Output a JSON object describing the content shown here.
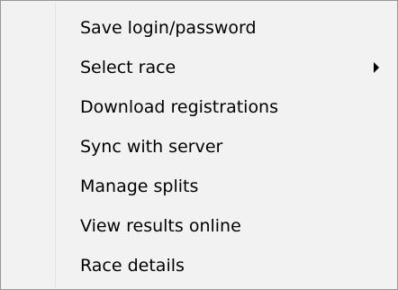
{
  "menu": {
    "items": [
      {
        "label": "Save login/password",
        "has_submenu": false
      },
      {
        "label": "Select race",
        "has_submenu": true,
        "submenu_icon": "chevron-right-icon"
      },
      {
        "label": "Download registrations",
        "has_submenu": false
      },
      {
        "label": "Sync with server",
        "has_submenu": false
      },
      {
        "label": "Manage splits",
        "has_submenu": false
      },
      {
        "label": "View results online",
        "has_submenu": false
      },
      {
        "label": "Race details",
        "has_submenu": false
      }
    ]
  }
}
